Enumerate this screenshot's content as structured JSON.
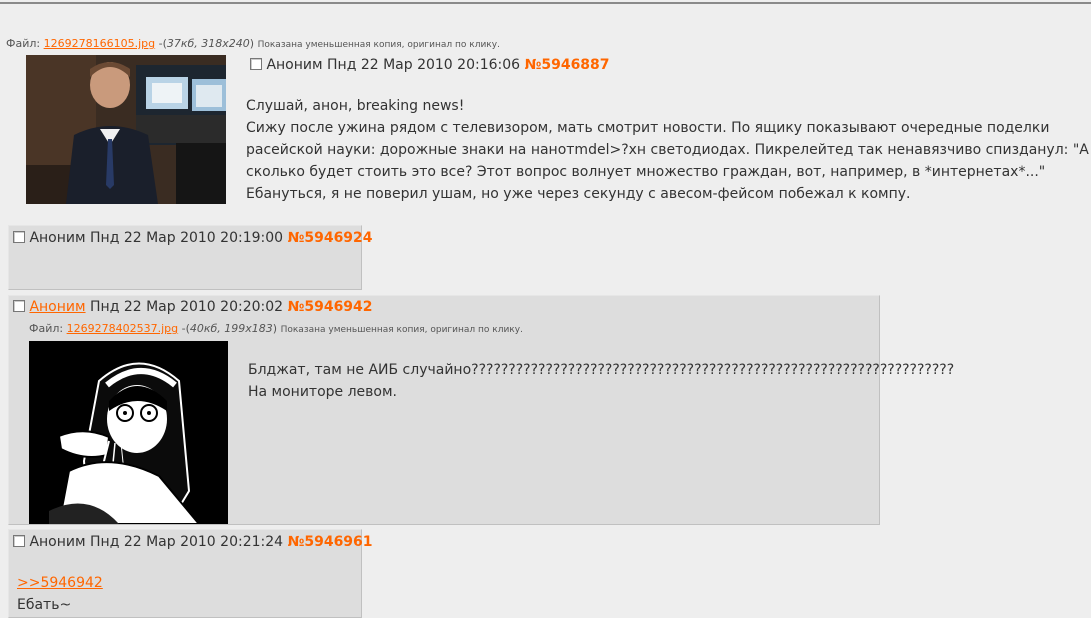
{
  "op": {
    "file_label": "Файл:",
    "file_name": "1269278166105.jpg",
    "file_meta_prefix": " -(",
    "file_meta": "37кб, 318x240",
    "file_meta_suffix": ")",
    "file_note": "Показана уменьшенная копия, оригинал по клику.",
    "author": "Аноним",
    "date": "Пнд 22 Мар 2010 20:16:06",
    "post_num": "№5946887",
    "lines": [
      "Слушай, анон, breaking news!",
      "Сижу после ужина рядом с телевизором, мать смотрит новости. По ящику показывают очередные поделки",
      "расейской науки: дорожные знаки на нанотmdel>?хн светодиодах. Пикрелейтед так ненавязчиво спизданул: \"А",
      "сколько будет стоить это все? Этот вопрос волнует множество граждан, вот, например, в *интернетах*...\"",
      "Ебануться, я не поверил ушам, но уже через секунду с авесом-фейсом побежал к компу."
    ]
  },
  "reply1": {
    "author": "Аноним",
    "date": "Пнд 22 Мар 2010 20:19:00",
    "post_num": "№5946924"
  },
  "reply2": {
    "author": "Аноним",
    "date": "Пнд 22 Мар 2010 20:20:02",
    "post_num": "№5946942",
    "file_label": "Файл:",
    "file_name": "1269278402537.jpg",
    "file_meta_prefix": " -(",
    "file_meta": "40кб, 199x183",
    "file_meta_suffix": ")",
    "file_note": "Показана уменьшенная копия, оригинал по клику.",
    "lines": [
      "Блджат, там не АИБ случайно?????????????????????????????????????????????????????????????????",
      "На мониторе левом."
    ]
  },
  "reply3": {
    "author": "Аноним",
    "date": "Пнд 22 Мар 2010 20:21:24",
    "post_num": "№5946961",
    "quote_link": ">>5946942",
    "text": "Ебать~"
  },
  "colors": {
    "accent": "#ff6600",
    "page_bg": "#eeeeee",
    "reply_bg": "#dddddd"
  }
}
